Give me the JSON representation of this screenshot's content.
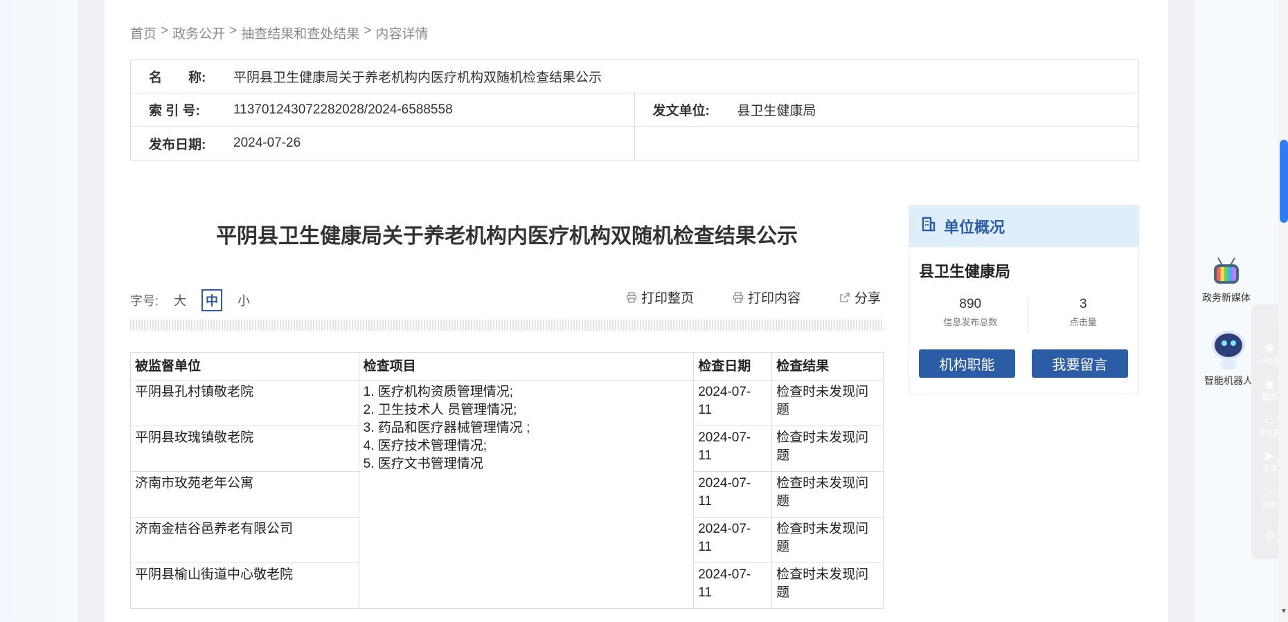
{
  "breadcrumb": [
    "首页",
    "政务公开",
    "抽查结果和查处结果",
    "内容详情"
  ],
  "breadcrumb_sep": ">",
  "meta": {
    "name_label": "名　　称:",
    "name_value": "平阴县卫生健康局关于养老机构内医疗机构双随机检查结果公示",
    "index_label": "索 引 号:",
    "index_value": "113701243072282028/2024-6588558",
    "issuer_label": "发文单位:",
    "issuer_value": "县卫生健康局",
    "date_label": "发布日期:",
    "date_value": "2024-07-26"
  },
  "article_title": "平阴县卫生健康局关于养老机构内医疗机构双随机检查结果公示",
  "font_size": {
    "label": "字号:",
    "large": "大",
    "medium": "中",
    "small": "小",
    "selected": "中"
  },
  "tools": {
    "print_page": "打印整页",
    "print_content": "打印内容",
    "share": "分享"
  },
  "table": {
    "headers": [
      "被监督单位",
      "检查项目",
      "检查日期",
      "检查结果"
    ],
    "items": [
      "1. 医疗机构资质管理情况;",
      "2. 卫生技术人 员管理情况;",
      "3. 药品和医疗器械管理情况 ;",
      "4. 医疗技术管理情况;",
      "5. 医疗文书管理情况"
    ],
    "rows": [
      {
        "unit": "平阴县孔村镇敬老院",
        "date_a": "2024-07-",
        "date_b": "11",
        "result_a": "检查时未发现问",
        "result_b": "题"
      },
      {
        "unit": "平阴县玫瑰镇敬老院",
        "date_a": "2024-07-",
        "date_b": "11",
        "result_a": "检查时未发现问",
        "result_b": "题"
      },
      {
        "unit": "济南市玫苑老年公寓",
        "date_a": "2024-07-",
        "date_b": "11",
        "result_a": "检查时未发现问",
        "result_b": "题"
      },
      {
        "unit": "济南金桔谷邑养老有限公司",
        "date_a": "2024-07-",
        "date_b": "11",
        "result_a": "检查时未发现问",
        "result_b": "题"
      },
      {
        "unit": "平阴县榆山街道中心敬老院",
        "date_a": "2024-07-",
        "date_b": "11",
        "result_a": "检查时未发现问",
        "result_b": "题"
      }
    ]
  },
  "unit_panel": {
    "title": "单位概况",
    "name": "县卫生健康局",
    "published_count": "890",
    "published_label": "信息发布总数",
    "clicks": "3",
    "clicks_label": "点击量",
    "btn_functions": "机构职能",
    "btn_message": "我要留言"
  },
  "floating": {
    "media": "政务新媒体",
    "robot": "智能机器人"
  },
  "side_toolbar": [
    "AI助手",
    "截图",
    "截全屏",
    "录屏",
    "搜索"
  ],
  "colors": {
    "accent": "#2b5ca6",
    "panel_head_bg": "#deeefb",
    "scroll_thumb": "#2f7df6"
  }
}
